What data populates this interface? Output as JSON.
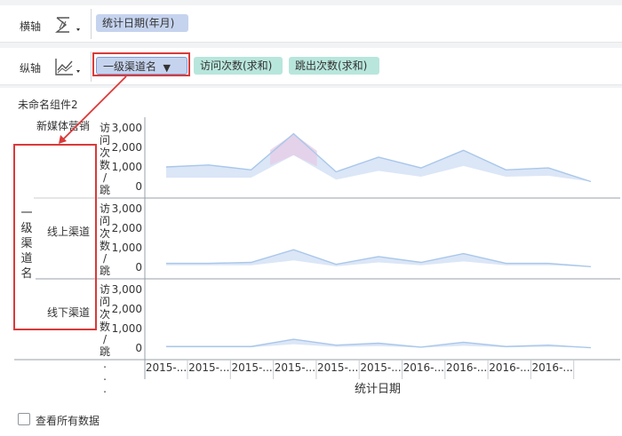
{
  "axes_config": {
    "horizontal": {
      "label": "横轴",
      "chip": "统计日期(年月)"
    },
    "vertical": {
      "label": "纵轴",
      "chips": [
        "一级渠道名",
        "访问次数(求和)",
        "跳出次数(求和)"
      ]
    }
  },
  "component": {
    "title": "未命名组件2"
  },
  "footer": {
    "show_all_label": "查看所有数据"
  },
  "colors": {
    "band_blue": "#dbe6f7",
    "line_blue": "#a9c7ea",
    "peak_purple": "#e6cde6",
    "redbox": "#d93a3a",
    "chip_blue": "#c5d3ee",
    "chip_teal": "#b8e6dc"
  },
  "chart_data": {
    "type": "area",
    "row_dimension_label": "一级渠道名",
    "xlabel": "统计日期",
    "x_ticks": [
      "2015-...",
      "2015-...",
      "2015-...",
      "2015-...",
      "2015-...",
      "2015-...",
      "2016-...",
      "2016-...",
      "2016-...",
      "2016-..."
    ],
    "y_ticks": [
      "3,000",
      "2,000",
      "1,000",
      "0"
    ],
    "y_axis_label": "访问次数/跳...",
    "ylim": [
      0,
      3000
    ],
    "rows": [
      {
        "name": "新媒体营销",
        "series_upper": [
          1000,
          1100,
          850,
          2700,
          750,
          1500,
          950,
          1850,
          850,
          950,
          250
        ],
        "series_lower": [
          450,
          450,
          450,
          1600,
          350,
          800,
          500,
          1050,
          500,
          550,
          250
        ]
      },
      {
        "name": "线上渠道",
        "series_upper": [
          200,
          200,
          250,
          900,
          150,
          550,
          250,
          700,
          200,
          200,
          30
        ],
        "series_lower": [
          100,
          100,
          100,
          350,
          50,
          250,
          100,
          300,
          100,
          100,
          30
        ]
      },
      {
        "name": "线下渠道",
        "series_upper": [
          80,
          80,
          80,
          450,
          150,
          250,
          50,
          300,
          80,
          150,
          20
        ],
        "series_lower": [
          40,
          40,
          40,
          200,
          60,
          100,
          20,
          120,
          40,
          60,
          20
        ]
      }
    ]
  }
}
